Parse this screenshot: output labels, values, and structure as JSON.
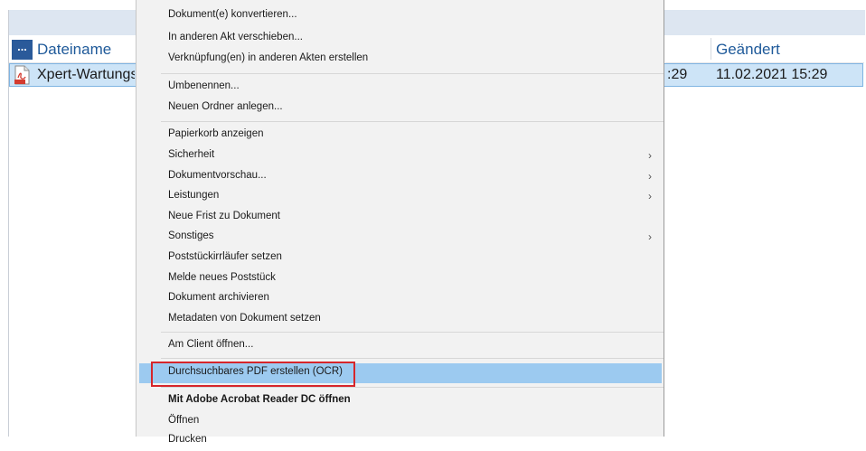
{
  "file_list": {
    "header_button": "...",
    "columns": {
      "name": "Dateiname",
      "changed": "Geändert"
    },
    "selected_row": {
      "name": "Xpert-Wartungs",
      "time_fragment": ":29",
      "changed": "11.02.2021 15:29"
    }
  },
  "context_menu": {
    "group1": [
      "Dokument(e) konvertieren...",
      "In anderen Akt verschieben...",
      "Verknüpfung(en) in anderen Akten erstellen"
    ],
    "group2": [
      "Umbenennen...",
      "Neuen Ordner anlegen..."
    ],
    "group3": [
      "Papierkorb anzeigen",
      "Sicherheit",
      "Dokumentvorschau...",
      "Leistungen",
      "Neue Frist zu Dokument",
      "Sonstiges",
      "Poststückirrläufer setzen",
      "Melde neues Poststück",
      "Dokument archivieren",
      "Metadaten von Dokument setzen"
    ],
    "group4": [
      "Am Client öffnen..."
    ],
    "highlighted": "Durchsuchbares PDF erstellen (OCR)",
    "group5": [
      "Mit Adobe Acrobat Reader DC öffnen",
      "Öffnen",
      "Drucken"
    ],
    "submenu_arrow": "›",
    "highlight_color": "#9ccaf0",
    "annotation_color": "#d6262b"
  }
}
